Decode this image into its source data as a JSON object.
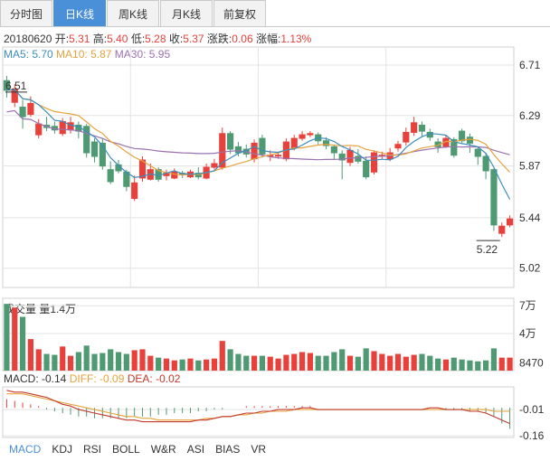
{
  "tabs": [
    {
      "label": "分时图",
      "active": false
    },
    {
      "label": "日K线",
      "active": true
    },
    {
      "label": "周K线",
      "active": false
    },
    {
      "label": "月K线",
      "active": false
    },
    {
      "label": "前复权",
      "active": false
    }
  ],
  "info": {
    "date": "20180620",
    "open_label": "开:",
    "open": "5.31",
    "high_label": "高:",
    "high": "5.40",
    "low_label": "低:",
    "low": "5.28",
    "close_label": "收:",
    "close": "5.37",
    "chg_label": "涨跌:",
    "chg": "0.06",
    "pct_label": "涨幅:",
    "pct": "1.13%"
  },
  "ma_legend": {
    "ma5": "MA5: 5.70",
    "ma10": "MA10: 5.87",
    "ma30": "MA30: 5.95"
  },
  "volume_legend": {
    "title": "成交量",
    "value": "量1.4万"
  },
  "macd_legend": {
    "macd": "MACD: -0.14",
    "diff": "DIFF: -0.09",
    "dea": "DEA: -0.02"
  },
  "bottom_tabs": [
    {
      "label": "MACD",
      "active": true
    },
    {
      "label": "KDJ",
      "active": false
    },
    {
      "label": "RSI",
      "active": false
    },
    {
      "label": "BOLL",
      "active": false
    },
    {
      "label": "W&R",
      "active": false
    },
    {
      "label": "ASI",
      "active": false
    },
    {
      "label": "BIAS",
      "active": false
    },
    {
      "label": "VR",
      "active": false
    }
  ],
  "colors": {
    "up": "#e8403a",
    "down": "#4f9a73",
    "ma5": "#3c8dbc",
    "ma10": "#e6a23c",
    "ma30": "#9b72b0",
    "dea": "#e6a23c",
    "diff": "#c0392b",
    "grid": "#e3e3e3",
    "active": "#4a90d9"
  },
  "chart_data": [
    {
      "type": "candlestick",
      "title": "",
      "y_ticks": [
        6.71,
        6.29,
        5.87,
        5.44,
        5.02
      ],
      "ylim": [
        4.86,
        6.86
      ],
      "max_annotation": "6.51",
      "min_annotation": "5.22",
      "candles": [
        [
          6.58,
          6.5,
          6.62,
          6.44
        ],
        [
          6.4,
          6.51,
          6.55,
          6.36
        ],
        [
          6.36,
          6.28,
          6.42,
          6.18
        ],
        [
          6.3,
          6.39,
          6.45,
          6.28
        ],
        [
          6.13,
          6.22,
          6.26,
          6.1
        ],
        [
          6.21,
          6.19,
          6.28,
          6.16
        ],
        [
          6.2,
          6.17,
          6.24,
          6.14
        ],
        [
          6.14,
          6.24,
          6.27,
          6.12
        ],
        [
          6.17,
          6.23,
          6.28,
          6.14
        ],
        [
          6.21,
          6.16,
          6.24,
          6.1
        ],
        [
          6.2,
          5.98,
          6.22,
          5.94
        ],
        [
          6.07,
          5.95,
          6.1,
          5.9
        ],
        [
          6.06,
          5.87,
          6.1,
          5.84
        ],
        [
          5.84,
          5.74,
          5.91,
          5.72
        ],
        [
          5.88,
          5.83,
          5.92,
          5.81
        ],
        [
          5.82,
          5.7,
          5.84,
          5.66
        ],
        [
          5.6,
          5.73,
          5.79,
          5.58
        ],
        [
          5.77,
          5.92,
          5.95,
          5.74
        ],
        [
          5.76,
          5.84,
          5.89,
          5.75
        ],
        [
          5.84,
          5.76,
          5.86,
          5.74
        ],
        [
          5.79,
          5.81,
          5.84,
          5.75
        ],
        [
          5.77,
          5.82,
          5.85,
          5.76
        ],
        [
          5.81,
          5.8,
          5.83,
          5.77
        ],
        [
          5.78,
          5.82,
          5.84,
          5.77
        ],
        [
          5.81,
          5.78,
          5.86,
          5.76
        ],
        [
          5.77,
          5.86,
          5.89,
          5.76
        ],
        [
          5.86,
          5.89,
          5.93,
          5.84
        ],
        [
          5.86,
          6.14,
          6.19,
          5.84
        ],
        [
          6.14,
          6.01,
          6.16,
          5.97
        ],
        [
          6.03,
          5.98,
          6.07,
          5.95
        ],
        [
          6.01,
          5.97,
          6.05,
          5.94
        ],
        [
          5.93,
          6.06,
          6.09,
          5.9
        ],
        [
          6.1,
          5.97,
          6.13,
          5.94
        ],
        [
          5.95,
          5.96,
          6.0,
          5.91
        ],
        [
          5.96,
          5.96,
          5.99,
          5.93
        ],
        [
          5.93,
          6.07,
          6.1,
          5.91
        ],
        [
          6.02,
          6.1,
          6.13,
          6.0
        ],
        [
          6.1,
          6.13,
          6.16,
          6.08
        ],
        [
          6.13,
          6.14,
          6.16,
          6.11
        ],
        [
          6.13,
          6.08,
          6.15,
          6.05
        ],
        [
          6.08,
          6.04,
          6.11,
          6.01
        ],
        [
          6.03,
          5.98,
          6.05,
          5.92
        ],
        [
          5.97,
          5.92,
          6.0,
          5.76
        ],
        [
          5.9,
          6.0,
          6.03,
          5.87
        ],
        [
          5.95,
          5.91,
          6.01,
          5.89
        ],
        [
          5.91,
          5.78,
          5.95,
          5.76
        ],
        [
          5.82,
          5.98,
          6.0,
          5.8
        ],
        [
          5.96,
          5.96,
          5.99,
          5.93
        ],
        [
          5.93,
          5.98,
          6.02,
          5.91
        ],
        [
          6.02,
          6.05,
          6.08,
          5.99
        ],
        [
          6.07,
          6.15,
          6.19,
          6.04
        ],
        [
          6.15,
          6.23,
          6.28,
          6.12
        ],
        [
          6.21,
          6.16,
          6.24,
          6.12
        ],
        [
          6.15,
          6.11,
          6.18,
          6.08
        ],
        [
          6.07,
          6.03,
          6.1,
          5.98
        ],
        [
          6.03,
          6.1,
          6.13,
          6.02
        ],
        [
          6.09,
          5.96,
          6.11,
          5.94
        ],
        [
          6.16,
          6.08,
          6.18,
          6.06
        ],
        [
          6.11,
          6.06,
          6.14,
          5.98
        ],
        [
          6.01,
          5.95,
          6.03,
          5.88
        ],
        [
          5.95,
          5.83,
          5.98,
          5.76
        ],
        [
          5.84,
          5.38,
          5.85,
          5.33
        ],
        [
          5.31,
          5.37,
          5.4,
          5.28
        ],
        [
          5.38,
          5.43,
          5.46,
          5.36
        ]
      ]
    },
    {
      "type": "bar",
      "title": "成交量",
      "y_ticks": [
        "7万",
        "4万",
        "8470"
      ],
      "values": [
        7.2,
        6.8,
        5.8,
        3.4,
        2.3,
        1.8,
        1.7,
        2.6,
        1.6,
        2.0,
        2.7,
        1.8,
        1.9,
        2.3,
        2.0,
        1.8,
        2.2,
        2.3,
        1.6,
        1.4,
        1.3,
        1.1,
        1.2,
        1.3,
        1.1,
        1.2,
        1.3,
        3.2,
        2.3,
        1.8,
        1.6,
        1.6,
        1.6,
        1.5,
        1.3,
        1.7,
        1.8,
        2.0,
        1.9,
        1.6,
        1.6,
        2.0,
        2.3,
        1.6,
        1.5,
        2.4,
        2.1,
        1.8,
        1.6,
        1.8,
        1.5,
        1.7,
        1.8,
        1.6,
        1.3,
        1.2,
        1.4,
        1.2,
        1.1,
        1.0,
        1.1,
        2.4,
        1.4,
        1.4
      ]
    },
    {
      "type": "line",
      "title": "MACD",
      "y_ticks": [
        -0.01,
        -0.16
      ],
      "histogram": [
        0.05,
        0.04,
        0.03,
        0.02,
        0.01,
        -0.01,
        -0.02,
        -0.03,
        -0.04,
        -0.05,
        -0.05,
        -0.06,
        -0.06,
        -0.06,
        -0.06,
        -0.06,
        -0.05,
        -0.05,
        -0.05,
        -0.04,
        -0.04,
        -0.03,
        -0.03,
        -0.03,
        -0.02,
        -0.02,
        -0.01,
        -0.01,
        0.0,
        0.0,
        0.01,
        0.01,
        0.01,
        0.01,
        0.01,
        0.01,
        0.01,
        0.01,
        0.01,
        0.0,
        0.0,
        0.0,
        0.0,
        0.0,
        0.0,
        0.0,
        0.0,
        0.0,
        0.0,
        0.0,
        0.0,
        0.0,
        0.0,
        0.0,
        0.0,
        -0.01,
        -0.01,
        -0.01,
        -0.02,
        -0.02,
        -0.03,
        -0.05,
        -0.09,
        -0.12
      ],
      "dea": [
        0.08,
        0.08,
        0.08,
        0.07,
        0.06,
        0.05,
        0.04,
        0.03,
        0.02,
        0.01,
        0.0,
        -0.01,
        -0.02,
        -0.03,
        -0.04,
        -0.05,
        -0.05,
        -0.06,
        -0.06,
        -0.07,
        -0.07,
        -0.07,
        -0.07,
        -0.07,
        -0.07,
        -0.06,
        -0.06,
        -0.05,
        -0.05,
        -0.04,
        -0.04,
        -0.03,
        -0.03,
        -0.02,
        -0.02,
        -0.02,
        -0.01,
        -0.01,
        -0.01,
        -0.01,
        -0.01,
        -0.01,
        -0.01,
        -0.01,
        -0.01,
        -0.01,
        -0.01,
        -0.01,
        -0.01,
        -0.01,
        -0.01,
        -0.01,
        -0.01,
        -0.01,
        -0.01,
        -0.01,
        -0.01,
        -0.01,
        -0.01,
        -0.01,
        -0.01,
        -0.02,
        -0.02,
        -0.02
      ],
      "diff": [
        0.1,
        0.09,
        0.09,
        0.08,
        0.07,
        0.06,
        0.04,
        0.02,
        0.01,
        -0.01,
        -0.02,
        -0.03,
        -0.04,
        -0.05,
        -0.06,
        -0.07,
        -0.07,
        -0.08,
        -0.08,
        -0.08,
        -0.08,
        -0.08,
        -0.08,
        -0.08,
        -0.07,
        -0.07,
        -0.06,
        -0.05,
        -0.05,
        -0.04,
        -0.03,
        -0.03,
        -0.02,
        -0.02,
        -0.01,
        -0.01,
        -0.01,
        0.0,
        0.0,
        -0.01,
        -0.01,
        -0.01,
        -0.01,
        -0.01,
        -0.01,
        -0.01,
        -0.01,
        -0.01,
        -0.01,
        -0.01,
        -0.01,
        -0.01,
        -0.01,
        0.0,
        0.0,
        -0.01,
        -0.01,
        -0.01,
        -0.02,
        -0.02,
        -0.03,
        -0.05,
        -0.07,
        -0.09
      ]
    }
  ]
}
